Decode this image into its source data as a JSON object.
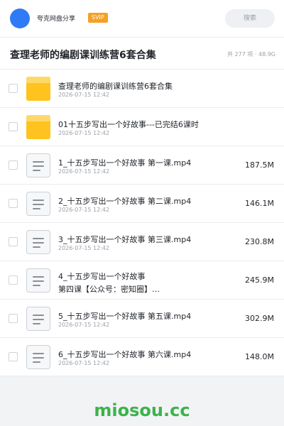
{
  "topbar": {
    "app_name": "夸克网盘分享",
    "svip_badge": "SVIP",
    "search_label": "搜索"
  },
  "header": {
    "title": "查理老师的编剧课训练营6套合集",
    "summary": "共 277 项 · 48.9G"
  },
  "files": [
    {
      "type": "folder",
      "name": "查理老师的编剧课训练营6套合集",
      "date": "2026-07-15 12:42",
      "size": ""
    },
    {
      "type": "folder",
      "name": "01十五步写出一个好故事---已完结6课时",
      "date": "2026-07-15 12:42",
      "size": ""
    },
    {
      "type": "file",
      "name": "1_十五步写出一个好故事 第一课.mp4",
      "date": "2026-07-15 12:42",
      "size": "187.5M"
    },
    {
      "type": "file",
      "name": "2_十五步写出一个好故事 第二课.mp4",
      "date": "2026-07-15 12:42",
      "size": "146.1M"
    },
    {
      "type": "file",
      "name": "3_十五步写出一个好故事 第三课.mp4",
      "date": "2026-07-15 12:42",
      "size": "230.8M"
    },
    {
      "type": "file",
      "name": "4_十五步写出一个好故事",
      "name_line2": "第四课【公众号：密知圈】…",
      "date": "",
      "size": "245.9M"
    },
    {
      "type": "file",
      "name": "5_十五步写出一个好故事 第五课.mp4",
      "date": "2026-07-15 12:42",
      "size": "302.9M"
    },
    {
      "type": "file",
      "name": "6_十五步写出一个好故事 第六课.mp4",
      "date": "2026-07-15 12:42",
      "size": "148.0M"
    }
  ],
  "watermark": "miosou.cc",
  "colors": {
    "accent": "#2f7bf5",
    "svip": "#f5a026",
    "folder": "#ffc31f",
    "watermark": "#3cb34a"
  }
}
